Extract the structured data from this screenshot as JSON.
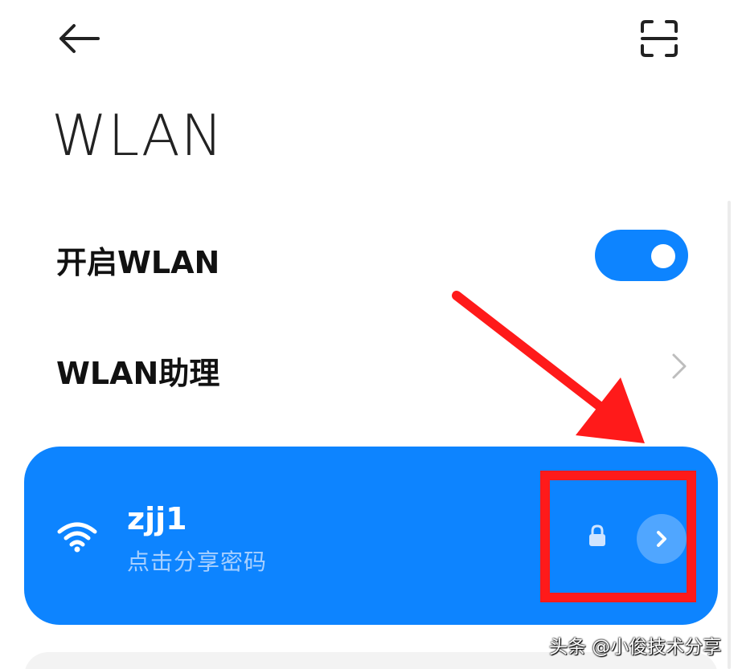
{
  "header": {
    "back_icon": "arrow-left-icon",
    "scan_icon": "scan-frame-icon"
  },
  "page_title": "WLAN",
  "wlan_toggle": {
    "label": "开启WLAN",
    "state": "on",
    "color": "#0d84ff"
  },
  "wlan_assistant": {
    "label": "WLAN助理",
    "icon": "chevron-right-icon"
  },
  "connected_network": {
    "ssid": "zjj1",
    "subtitle": "点击分享密码",
    "icons": [
      "wifi-icon",
      "lock-icon",
      "chevron-right-circle-icon"
    ],
    "background": "#0d84ff"
  },
  "annotation": {
    "arrow_color": "#ff1a1a",
    "box_color": "#ff1a1a"
  },
  "watermark": "头条 @小俊技术分享"
}
